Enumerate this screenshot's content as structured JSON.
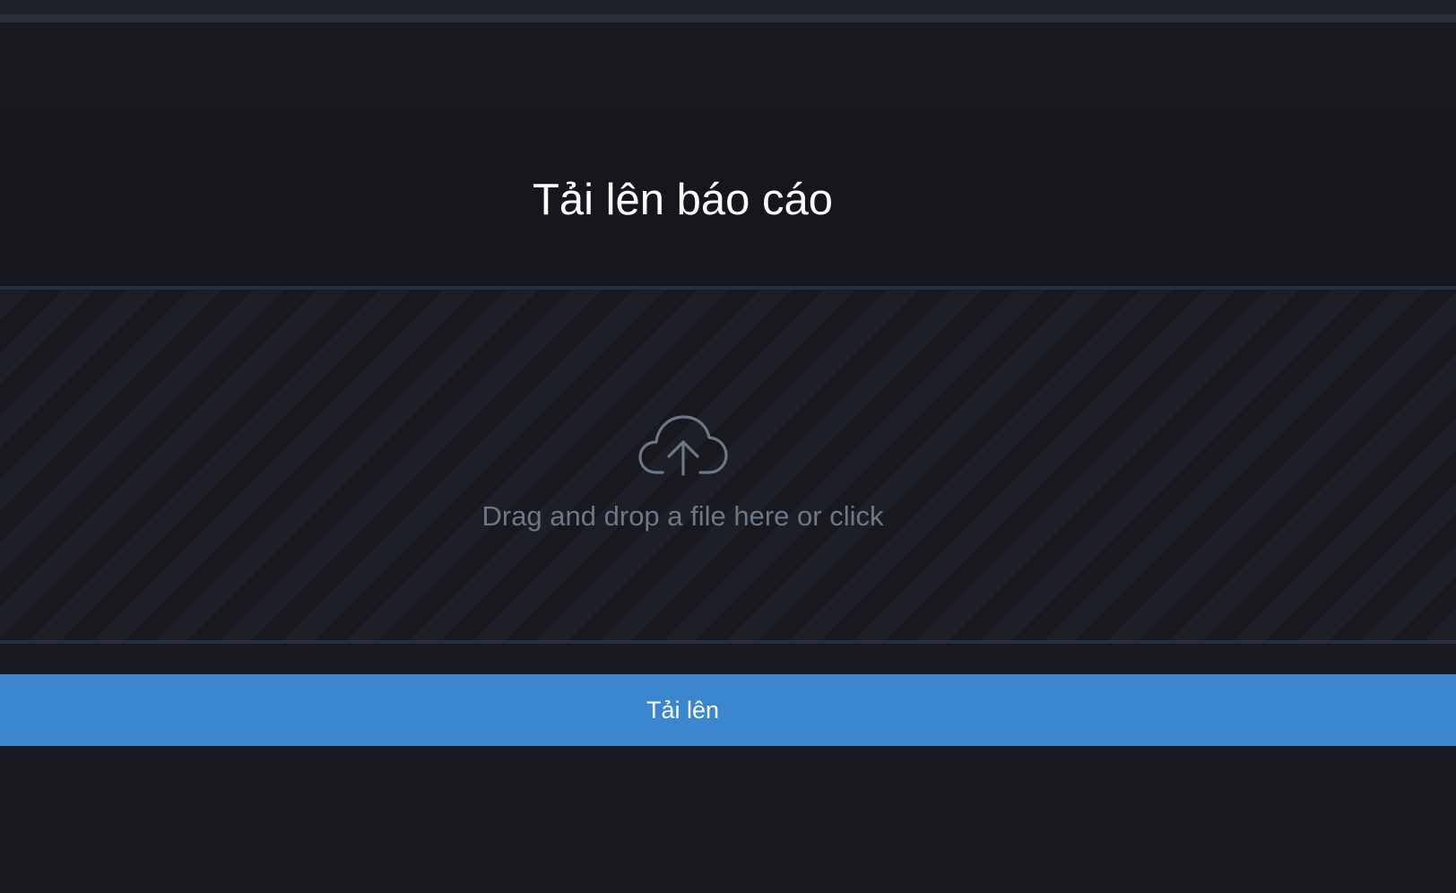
{
  "dialog": {
    "title": "Tải lên báo cáo"
  },
  "dropzone": {
    "icon": "cloud-upload-icon",
    "instruction": "Drag and drop a file here or click"
  },
  "actions": {
    "upload_label": "Tải lên"
  },
  "colors": {
    "background": "#17191e",
    "stripe": "#1c1f25",
    "dropzone_border": "#243040",
    "accent": "#3a87d0",
    "muted_text": "#6d7787",
    "title_text": "#ffffff"
  }
}
